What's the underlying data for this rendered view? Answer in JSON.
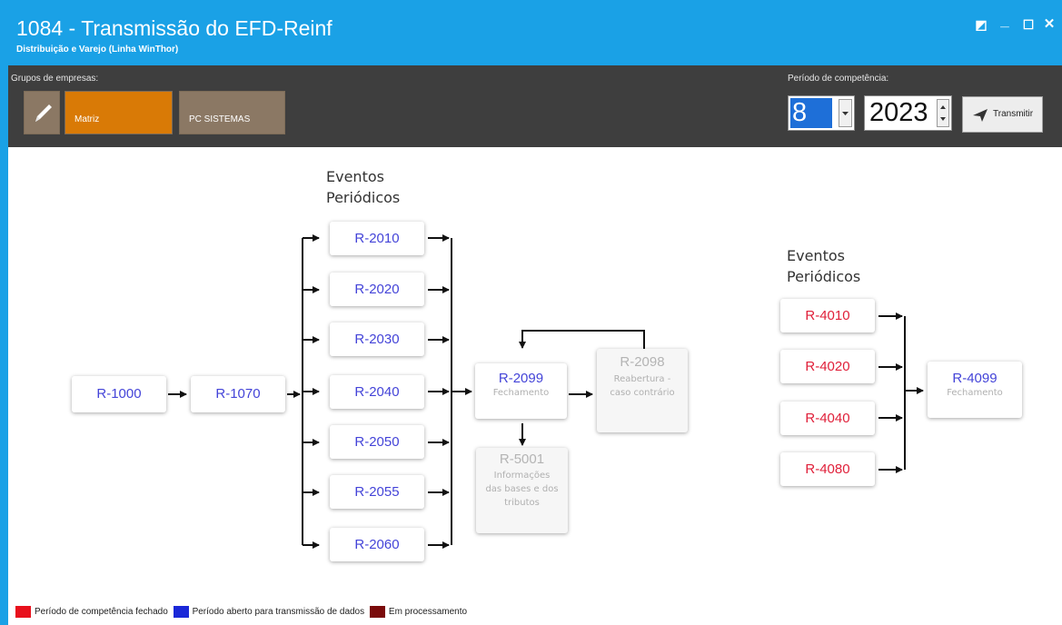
{
  "window": {
    "title": "1084 - Transmissão do EFD-Reinf",
    "subtitle": "Distribuição e Varejo (Linha WinThor)",
    "controls": {
      "restore": "◩",
      "minimize": "_",
      "maximize": "☐",
      "close": "✕"
    }
  },
  "toolbar": {
    "groups_label": "Grupos de empresas:",
    "edit_icon": "pencil-icon",
    "groups": [
      {
        "label": "Matriz",
        "color": "#d97a06"
      },
      {
        "label": "PC SISTEMAS",
        "color": "#8b7864"
      }
    ],
    "period_label": "Período de competência:",
    "month": "8",
    "year": "2023",
    "transmit_label": "Transmitir",
    "transmit_icon": "paper-plane-icon"
  },
  "diagram": {
    "heading_left": "Eventos\nPeriódicos",
    "heading_right": "Eventos\nPeriódicos",
    "r1000": "R-1000",
    "r1070": "R-1070",
    "periodic": [
      "R-2010",
      "R-2020",
      "R-2030",
      "R-2040",
      "R-2050",
      "R-2055",
      "R-2060"
    ],
    "r2099": {
      "code": "R-2099",
      "desc": "Fechamento"
    },
    "r2098": {
      "code": "R-2098",
      "desc": "Reabertura - caso contrário"
    },
    "r5001": {
      "code": "R-5001",
      "desc": "Informações das bases e dos tributos"
    },
    "r4000": [
      "R-4010",
      "R-4020",
      "R-4040",
      "R-4080"
    ],
    "r4099": {
      "code": "R-4099",
      "desc": "Fechamento"
    }
  },
  "legend": [
    {
      "label": "Período de competência fechado",
      "color": "#e8101c"
    },
    {
      "label": "Período aberto para transmissão de dados",
      "color": "#1a28d8"
    },
    {
      "label": "Em processamento",
      "color": "#7a0a0a"
    }
  ]
}
